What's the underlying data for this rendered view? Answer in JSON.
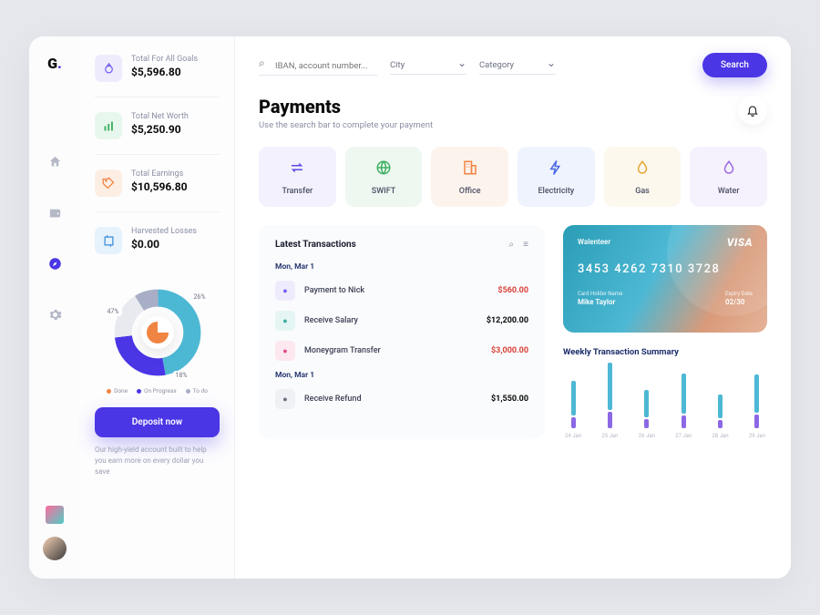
{
  "logo": "G",
  "stats": [
    {
      "label": "Total For All Goals",
      "value": "$5,596.80"
    },
    {
      "label": "Total Net Worth",
      "value": "$5,250.90"
    },
    {
      "label": "Total Earnings",
      "value": "$10,596.80"
    },
    {
      "label": "Harvested Losses",
      "value": "$0.00"
    }
  ],
  "chart_data": {
    "donut": {
      "type": "pie",
      "values": [
        47,
        26,
        18,
        9
      ],
      "labels": [
        "47%",
        "26%",
        "18%"
      ],
      "legend": [
        "Done",
        "On Progress",
        "To do"
      ],
      "colors": [
        "#f08442",
        "#4a36e5",
        "#4db8d4",
        "#a8aec5"
      ]
    },
    "weekly": {
      "type": "bar",
      "title": "Weekly Transaction Summary",
      "categories": [
        "24 Jan",
        "25 Jan",
        "26 Jan",
        "27 Jan",
        "28 Jan",
        "29 Jan"
      ],
      "series": [
        {
          "name": "blue",
          "values": [
            38,
            52,
            30,
            44,
            26,
            42
          ],
          "color": "#4db8d4"
        },
        {
          "name": "purple",
          "values": [
            12,
            18,
            10,
            14,
            9,
            15
          ],
          "color": "#8b68e5"
        }
      ],
      "ylim": [
        0,
        70
      ]
    }
  },
  "deposit": {
    "button": "Deposit now",
    "desc": "Our high-yield account built to help you earn more on every dollar you save"
  },
  "search": {
    "placeholder": "IBAN, account number...",
    "city": "City",
    "category": "Category",
    "button": "Search"
  },
  "page": {
    "title": "Payments",
    "subtitle": "Use the search bar to complete your payment"
  },
  "categories": [
    "Transfer",
    "SWIFT",
    "Office",
    "Electricity",
    "Gas",
    "Water"
  ],
  "transactions": {
    "title": "Latest Transactions",
    "groups": [
      {
        "date": "Mon, Mar 1",
        "items": [
          {
            "name": "Payment to Nick",
            "amount": "$560.00",
            "neg": true,
            "icon": "purple"
          },
          {
            "name": "Receive Salary",
            "amount": "$12,200.00",
            "neg": false,
            "icon": "teal"
          },
          {
            "name": "Moneygram Transfer",
            "amount": "$3,000.00",
            "neg": true,
            "icon": "pink"
          }
        ]
      },
      {
        "date": "Mon, Mar 1",
        "items": [
          {
            "name": "Receive Refund",
            "amount": "$1,550.00",
            "neg": false,
            "icon": "gray"
          }
        ]
      }
    ]
  },
  "card": {
    "brand": "Walenteer",
    "network": "VISA",
    "number": "3453 4262 7310 3728",
    "holder_label": "Card Holder Name",
    "holder": "Mike Taylor",
    "expiry_label": "Expiry Date",
    "expiry": "02/30"
  }
}
